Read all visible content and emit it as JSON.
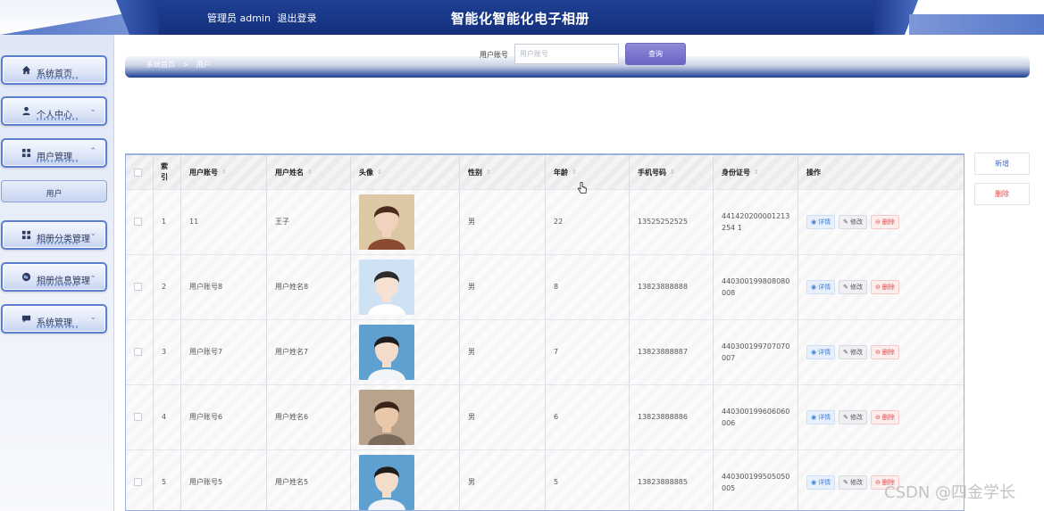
{
  "header": {
    "user_label": "管理员 admin",
    "logout_label": "退出登录",
    "app_title": "智能化智能化电子相册"
  },
  "sidebar": {
    "items": [
      {
        "label": "系统首页",
        "icon": "home-icon"
      },
      {
        "label": "个人中心",
        "icon": "person-icon"
      },
      {
        "label": "用户管理",
        "icon": "grid-icon"
      },
      {
        "label": "用户",
        "icon": ""
      },
      {
        "label": "相册分类管理",
        "icon": "grid-icon"
      },
      {
        "label": "相册信息管理",
        "icon": "globe-icon"
      },
      {
        "label": "系统管理",
        "icon": "chat-icon"
      }
    ]
  },
  "breadcrumb": {
    "home": "系统首页",
    "separator": ">",
    "current": "用户"
  },
  "search": {
    "label": "用户账号",
    "placeholder": "用户账号",
    "button_label": "查询"
  },
  "actions": {
    "add_label": "新增",
    "delete_label": "删除"
  },
  "table": {
    "columns": [
      "索引",
      "用户账号",
      "用户姓名",
      "头像",
      "性别",
      "年龄",
      "手机号码",
      "身份证号",
      "操作"
    ],
    "index_header": "索\n引",
    "rows": [
      {
        "index": "1",
        "account": "11",
        "name": "王子",
        "gender": "男",
        "age": "22",
        "phone": "13525252525",
        "id_card": "441420200001213254 1"
      },
      {
        "index": "2",
        "account": "用户账号8",
        "name": "用户姓名8",
        "gender": "男",
        "age": "8",
        "phone": "13823888888",
        "id_card": "440300199808080008"
      },
      {
        "index": "3",
        "account": "用户账号7",
        "name": "用户姓名7",
        "gender": "男",
        "age": "7",
        "phone": "13823888887",
        "id_card": "440300199707070007"
      },
      {
        "index": "4",
        "account": "用户账号6",
        "name": "用户姓名6",
        "gender": "男",
        "age": "6",
        "phone": "13823888886",
        "id_card": "440300199606060006"
      },
      {
        "index": "5",
        "account": "用户账号5",
        "name": "用户姓名5",
        "gender": "男",
        "age": "5",
        "phone": "13823888885",
        "id_card": "440300199505050005"
      }
    ],
    "row_actions": {
      "detail": "详情",
      "edit": "修改",
      "delete": "删除"
    }
  },
  "watermark": "CSDN @四金学长",
  "colors": {
    "header_blue": "#1e3f93",
    "accent_purple": "#6a65c4",
    "detail_blue": "#3d7fd9",
    "delete_red": "#e04a4a"
  }
}
